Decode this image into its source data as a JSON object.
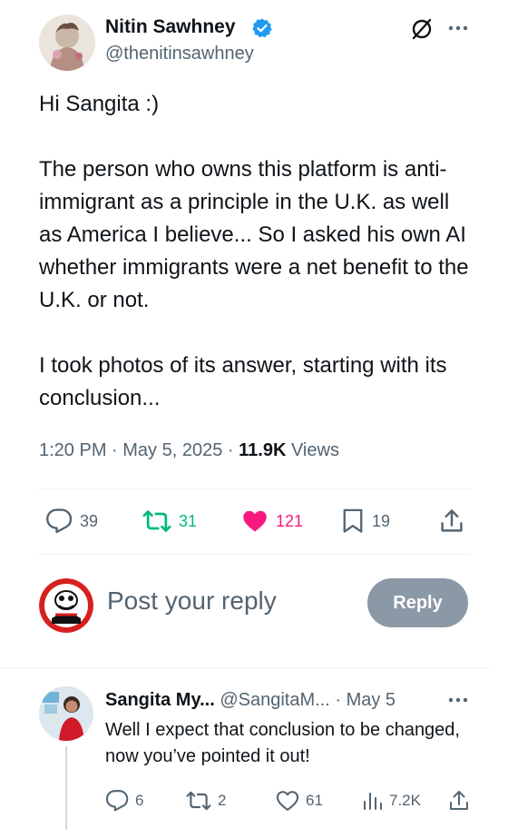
{
  "tweet": {
    "author_name": "Nitin Sawhney",
    "author_handle": "@thenitinsawhney",
    "verified": true,
    "body": "Hi Sangita :)\n\nThe person who owns this platform is anti-immigrant as a principle in the U.K. as well as America I believe... So I asked his own AI whether immigrants were a net benefit to the U.K. or not.\n\nI took photos of its answer, starting with its conclusion...",
    "time": "1:20 PM",
    "date": "May 5, 2025",
    "views_count": "11.9K",
    "views_label": "Views",
    "stats": {
      "replies": "39",
      "reposts": "31",
      "likes": "121",
      "bookmarks": "19"
    }
  },
  "composer": {
    "placeholder": "Post your reply",
    "button_label": "Reply"
  },
  "reply": {
    "author_name": "Sangita My...",
    "author_handle": "@SangitaM...",
    "date": "· May 5",
    "text": "Well I expect that conclusion to be changed, now you’ve pointed it out!",
    "stats": {
      "replies": "6",
      "reposts": "2",
      "likes": "61",
      "views": "7.2K"
    }
  },
  "colors": {
    "text": "#0f1419",
    "secondary": "#536471",
    "verified": "#1d9bf0",
    "repost_active": "#00ba7c",
    "like_active": "#f91880",
    "reply_button": "#8b98a5"
  },
  "icons": [
    "verified-badge-icon",
    "grok-icon",
    "more-icon",
    "reply-icon",
    "repost-icon",
    "like-icon",
    "bookmark-icon",
    "share-icon",
    "views-icon"
  ]
}
